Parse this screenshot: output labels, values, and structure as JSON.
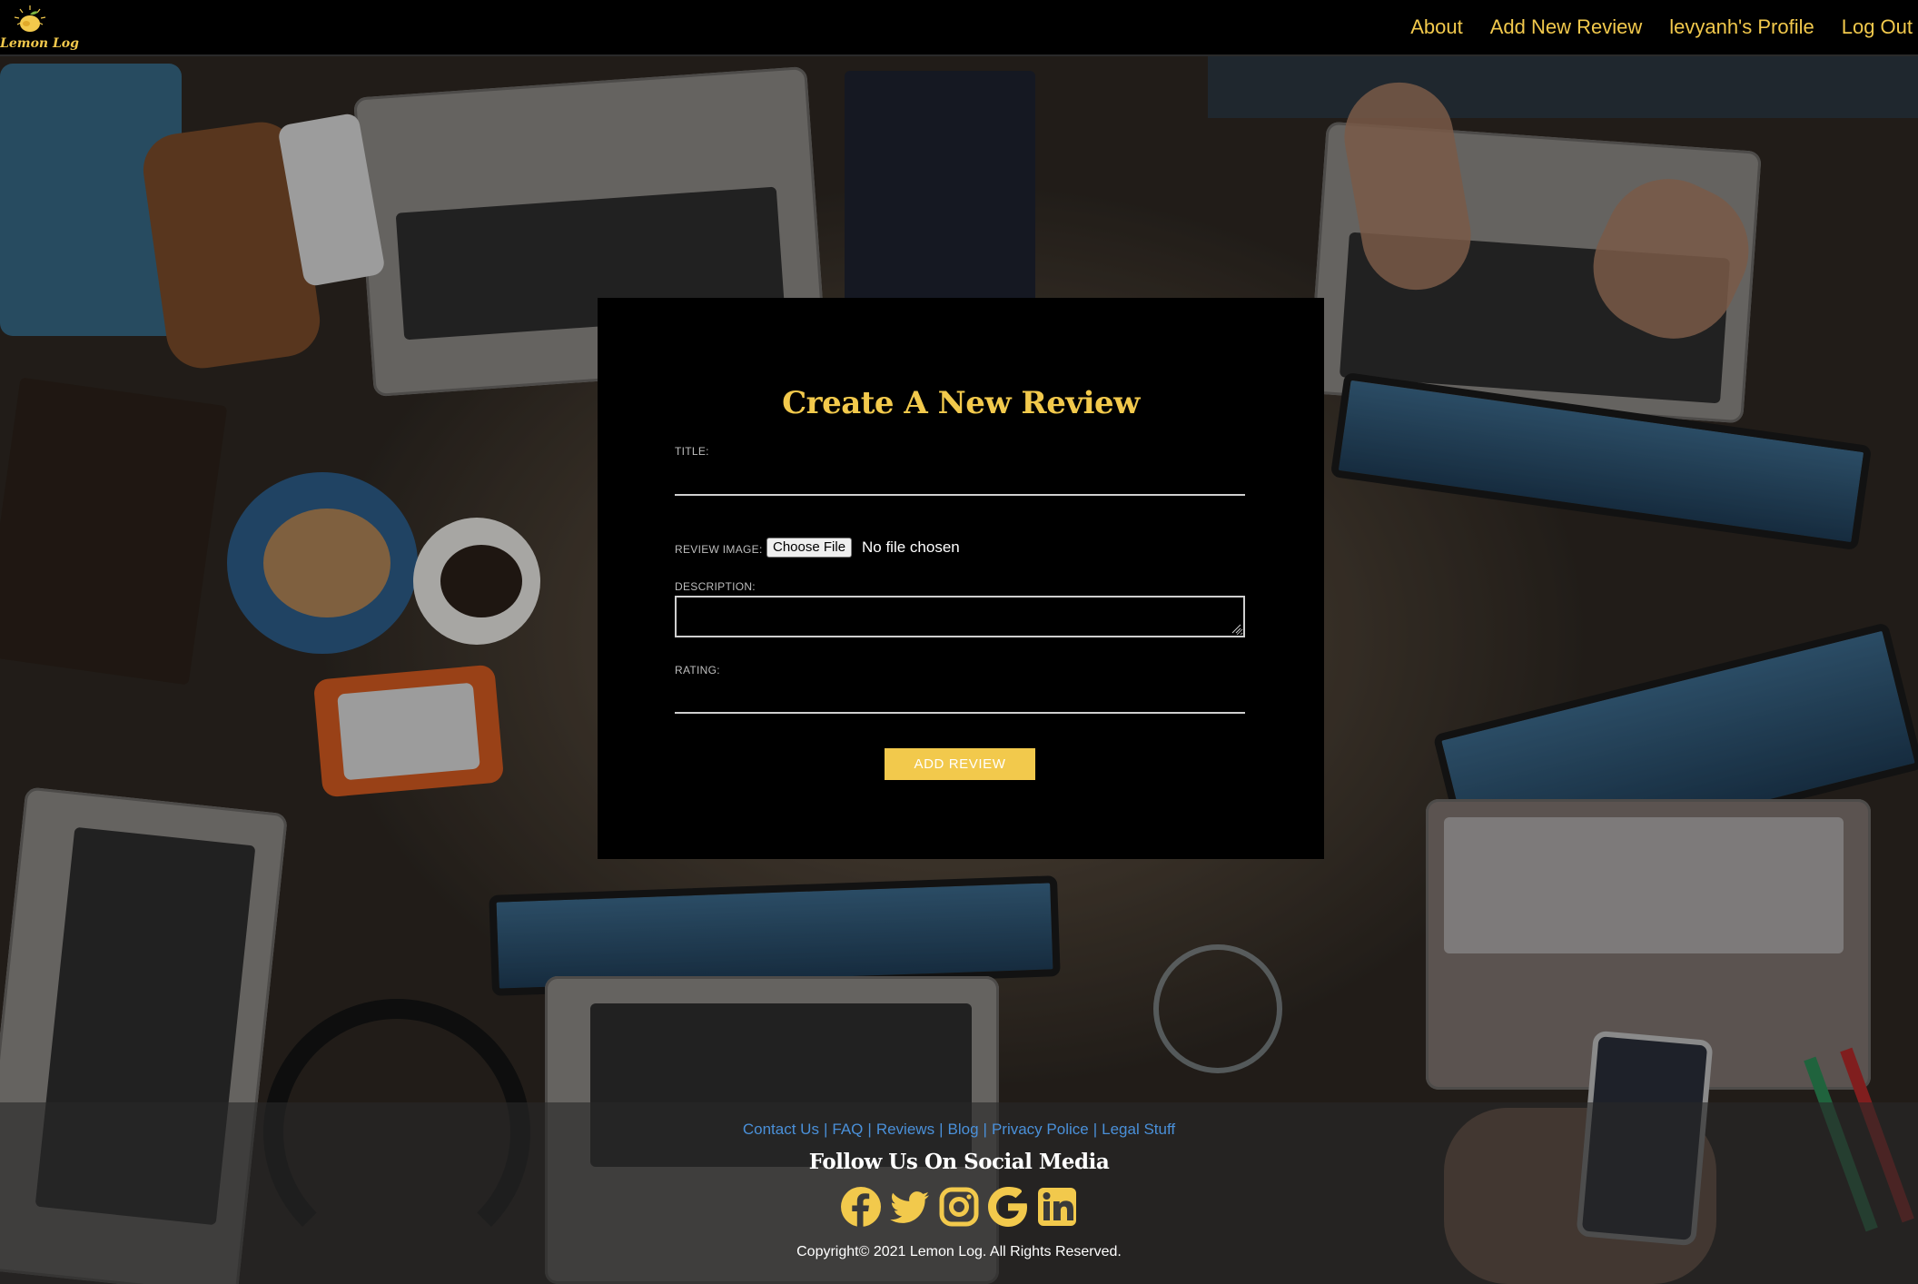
{
  "brand": {
    "name": "Lemon Log",
    "accent_color": "#f2c94c",
    "link_color": "#4a90d9"
  },
  "nav": {
    "items": [
      {
        "label": "About"
      },
      {
        "label": "Add New Review"
      },
      {
        "label": "levyanh's Profile"
      },
      {
        "label": "Log Out"
      }
    ]
  },
  "form": {
    "title": "Create A New Review",
    "title_label": "TITLE:",
    "title_value": "",
    "image_label": "REVIEW IMAGE:",
    "file_button": "Choose File",
    "file_status": "No file chosen",
    "description_label": "DESCRIPTION:",
    "description_value": "",
    "rating_label": "RATING:",
    "rating_value": "",
    "submit_label": "ADD REVIEW"
  },
  "footer": {
    "links": [
      {
        "label": "Contact Us"
      },
      {
        "label": "FAQ"
      },
      {
        "label": "Reviews"
      },
      {
        "label": "Blog"
      },
      {
        "label": "Privacy Police"
      },
      {
        "label": "Legal Stuff"
      }
    ],
    "follow_title": "Follow Us On Social Media",
    "social_icons": [
      "facebook-icon",
      "twitter-icon",
      "instagram-icon",
      "google-icon",
      "linkedin-icon"
    ],
    "copyright": "Copyright© 2021 Lemon Log. All Rights Reserved."
  }
}
